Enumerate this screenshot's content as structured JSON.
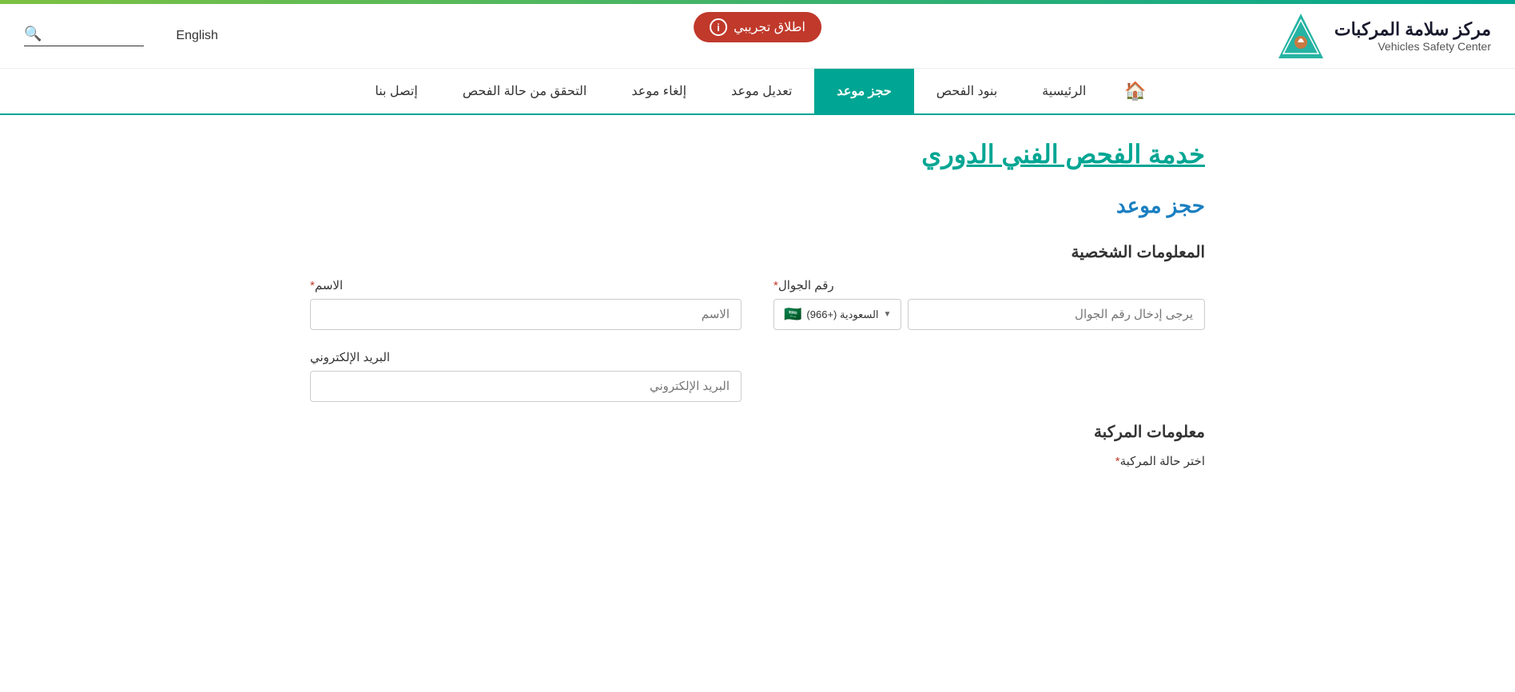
{
  "topBar": {
    "color": "#00a693"
  },
  "header": {
    "logoArabic": "مركز سلامة المركبات",
    "logoEnglish": "Vehicles Safety Center",
    "searchPlaceholder": "بحث",
    "languageToggle": "English",
    "betaButton": "اطلاق تجريبي"
  },
  "nav": {
    "home": "🏠",
    "items": [
      {
        "id": "home-page",
        "label": "الرئيسية",
        "active": false
      },
      {
        "id": "inspection-standards",
        "label": "بنود الفحص",
        "active": false
      },
      {
        "id": "book-appointment",
        "label": "حجز موعد",
        "active": true
      },
      {
        "id": "modify-appointment",
        "label": "تعديل موعد",
        "active": false
      },
      {
        "id": "cancel-appointment",
        "label": "إلغاء موعد",
        "active": false
      },
      {
        "id": "check-status",
        "label": "التحقق من حالة الفحص",
        "active": false
      },
      {
        "id": "contact-us",
        "label": "إتصل بنا",
        "active": false
      }
    ]
  },
  "page": {
    "pageTitle": "خدمة الفحص الفني الدوري",
    "sectionTitle": "حجز موعد",
    "personalInfoTitle": "المعلومات الشخصية",
    "nameLabel": "الاسم",
    "nameRequired": "*",
    "namePlaceholder": "الاسم",
    "phoneLabel": "رقم الجوال",
    "phoneRequired": "*",
    "phonePlaceholder": "يرجى إدخال رقم الجوال",
    "countryCode": "السعودية (+966)",
    "emailLabel": "البريد الإلكتروني",
    "emailPlaceholder": "البريد الإلكتروني",
    "vehicleInfoTitle": "معلومات المركبة",
    "vehicleStatusLabel": "اختر حالة المركبة",
    "vehicleStatusRequired": "*"
  }
}
